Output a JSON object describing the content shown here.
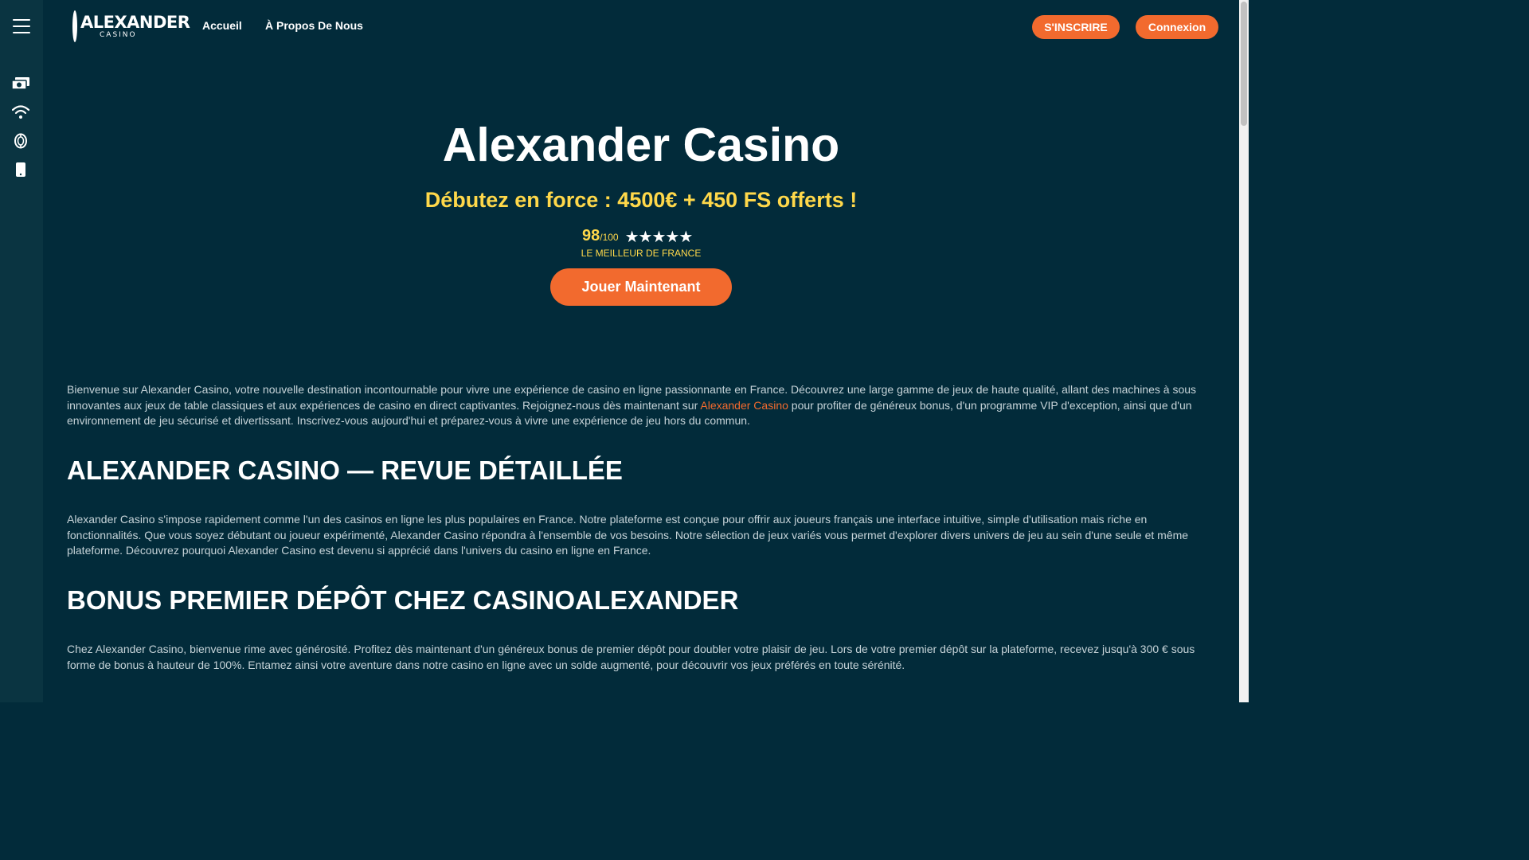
{
  "nav": {
    "logo_main": "ALEXANDER",
    "logo_sub": "CASINO",
    "home": "Accueil",
    "about": "À Propos De Nous",
    "register": "S'INSCRIRE",
    "login": "Connexion"
  },
  "sidebar": {
    "icons": [
      "money-icon",
      "wifi-icon",
      "chip-icon",
      "mobile-icon"
    ]
  },
  "hero": {
    "title": "Alexander Casino",
    "subtitle": "Débutez en force : 4500€ + 450 FS offerts !",
    "score": "98",
    "score_max": "/100",
    "stars": "★★★★★",
    "stars_value": 5,
    "caption": "LE MEILLEUR DE FRANCE",
    "cta": "Jouer Maintenant"
  },
  "content": {
    "intro_before": "Bienvenue sur Alexander Casino, votre nouvelle destination incontournable pour vivre une expérience de casino en ligne passionnante en France. Découvrez une large gamme de jeux de haute qualité, allant des machines à sous innovantes aux jeux de table classiques et aux expériences de casino en direct captivantes. Rejoignez-nous dès maintenant sur ",
    "intro_link": "Alexander Casino",
    "intro_after": " pour profiter de généreux bonus, d'un programme VIP d'exception, ainsi que d'un environnement de jeu sécurisé et divertissant. Inscrivez-vous aujourd'hui et préparez-vous à vivre une expérience de jeu hors du commun.",
    "heading1": "ALEXANDER CASINO — REVUE DÉTAILLÉE",
    "para1": "Alexander Casino s'impose rapidement comme l'un des casinos en ligne les plus populaires en France. Notre plateforme est conçue pour offrir aux joueurs français une interface intuitive, simple d'utilisation mais riche en fonctionnalités. Que vous soyez débutant ou joueur expérimenté, Alexander Casino répondra à l'ensemble de vos besoins. Notre sélection de jeux variés vous permet d'explorer divers univers de jeu au sein d'une seule et même plateforme. Découvrez pourquoi Alexander Casino est devenu si apprécié dans l'univers du casino en ligne en France.",
    "heading2": "BONUS PREMIER DÉPÔT CHEZ CASINOALEXANDER",
    "para2": "Chez Alexander Casino, bienvenue rime avec générosité. Profitez dès maintenant d'un généreux bonus de premier dépôt pour doubler votre plaisir de jeu. Lors de votre premier dépôt sur la plateforme, recevez jusqu'à 300 € sous forme de bonus à hauteur de 100%. Entamez ainsi votre aventure dans notre casino en ligne avec un solde augmenté, pour découvrir vos jeux préférés en toute sérénité."
  },
  "colors": {
    "background": "#022b3a",
    "sidebar": "#0a3441",
    "accent": "#f26a2e",
    "highlight": "#ffd84a"
  }
}
